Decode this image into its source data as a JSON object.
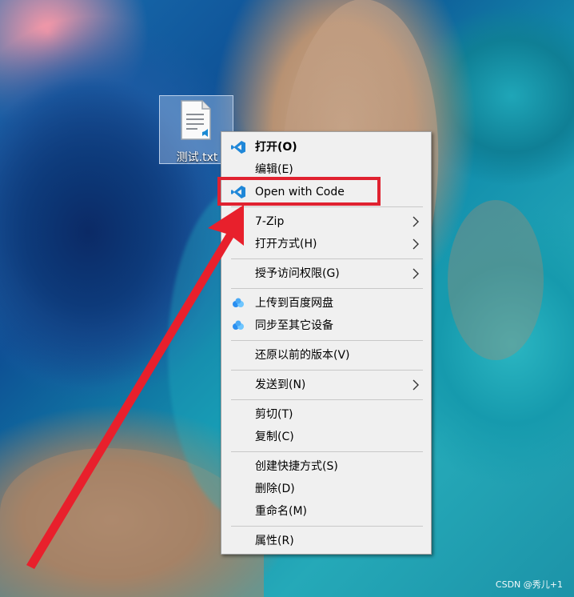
{
  "desktop": {
    "file_icon_label": "测试.txt"
  },
  "context_menu": {
    "items": [
      {
        "label": "打开(O)",
        "icon": "vscode-icon",
        "bold": true
      },
      {
        "label": "编辑(E)"
      },
      {
        "label": "Open with Code",
        "icon": "vscode-icon",
        "highlighted": true
      },
      {
        "label": "7-Zip",
        "submenu": true
      },
      {
        "label": "打开方式(H)",
        "submenu": true
      },
      {
        "label": "授予访问权限(G)",
        "submenu": true
      },
      {
        "label": "上传到百度网盘",
        "icon": "baidu-netdisk-icon"
      },
      {
        "label": "同步至其它设备",
        "icon": "baidu-netdisk-icon"
      },
      {
        "label": "还原以前的版本(V)"
      },
      {
        "label": "发送到(N)",
        "submenu": true
      },
      {
        "label": "剪切(T)"
      },
      {
        "label": "复制(C)"
      },
      {
        "label": "创建快捷方式(S)"
      },
      {
        "label": "删除(D)"
      },
      {
        "label": "重命名(M)"
      },
      {
        "label": "属性(R)"
      }
    ]
  },
  "annotation": {
    "highlight_color": "#e02230",
    "arrow_color": "#e8202c"
  },
  "watermark": "CSDN @秀儿+1"
}
